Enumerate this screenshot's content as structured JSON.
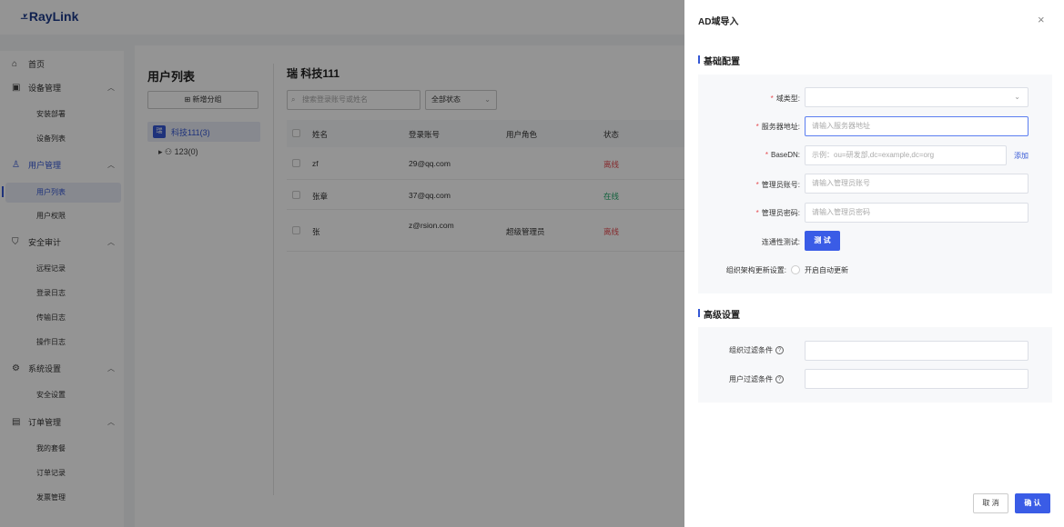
{
  "brand": {
    "logo_text": "RayLink",
    "accent": "#3457d5"
  },
  "sidebar": {
    "items": [
      {
        "icon": "home-icon",
        "label": "首页"
      },
      {
        "icon": "device-icon",
        "label": "设备管理",
        "children": [
          "安装部署",
          "设备列表"
        ]
      },
      {
        "icon": "user-icon",
        "label": "用户管理",
        "children": [
          "用户列表",
          "用户权限"
        ]
      },
      {
        "icon": "shield-icon",
        "label": "安全审计",
        "children": [
          "远程记录",
          "登录日志",
          "传输日志",
          "操作日志"
        ]
      },
      {
        "icon": "gear-icon",
        "label": "系统设置",
        "children": [
          "安全设置"
        ]
      },
      {
        "icon": "order-icon",
        "label": "订单管理",
        "children": [
          "我的套餐",
          "订单记录",
          "发票管理"
        ]
      }
    ],
    "active_child": "用户列表"
  },
  "main": {
    "title": "用户列表",
    "add_group_label": "新增分组",
    "tree": {
      "root_badge": "瑞",
      "root_label": "科技111(3)",
      "child_label": "123(0)"
    },
    "org_title": "瑞 科技111",
    "search_placeholder": "搜索登录账号或姓名",
    "status_filter": "全部状态",
    "table": {
      "headers": [
        "姓名",
        "登录账号",
        "用户角色",
        "状态"
      ],
      "rows": [
        {
          "name": "zf",
          "account": "29@qq.com",
          "role": "",
          "status": "离线"
        },
        {
          "name": "张章",
          "account": "37@qq.com",
          "role": "",
          "status": "在线"
        },
        {
          "name": "张",
          "account": "z@rsion.com",
          "role": "超级管理员",
          "status": "离线"
        }
      ]
    }
  },
  "drawer": {
    "title": "AD域导入",
    "close_label": "×",
    "basic_section": "基础配置",
    "fields": {
      "domain_type": {
        "label": "域类型:",
        "value": ""
      },
      "server_address": {
        "label": "服务器地址:",
        "placeholder": "请输入服务器地址"
      },
      "base_dn": {
        "label": "BaseDN:",
        "placeholder": "示例：ou=研发部,dc=example,dc=org",
        "action": "添加"
      },
      "admin_account": {
        "label": "管理员账号:",
        "placeholder": "请输入管理员账号"
      },
      "admin_password": {
        "label": "管理员密码:",
        "placeholder": "请输入管理员密码"
      },
      "connectivity": {
        "label": "连通性测试:",
        "button": "测 试"
      },
      "org_update": {
        "label": "组织架构更新设置:",
        "option": "开启自动更新"
      }
    },
    "advanced_section": "高级设置",
    "advanced_fields": {
      "org_filter": {
        "label": "组织过滤条件",
        "value": ""
      },
      "user_filter": {
        "label": "用户过滤条件",
        "value": ""
      }
    },
    "cancel_label": "取 消",
    "confirm_label": "确 认"
  }
}
